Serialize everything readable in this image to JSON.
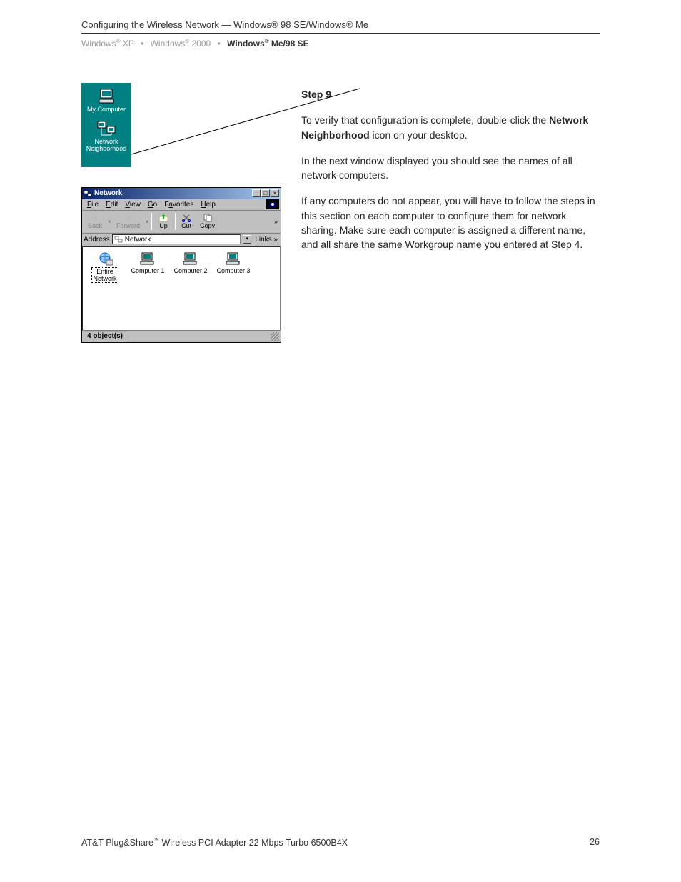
{
  "header": {
    "title": "Configuring the Wireless Network — Windows® 98 SE/Windows® Me"
  },
  "breadcrumb": {
    "item1": "Windows",
    "sup1": "®",
    "item1b": " XP",
    "sep1": "•",
    "item2": "Windows",
    "sup2": "®",
    "item2b": " 2000",
    "sep2": "•",
    "item3": "Windows",
    "sup3": "®",
    "item3b": " Me/98 SE"
  },
  "desktop": {
    "icon1_label": "My Computer",
    "icon2_line1": "Network",
    "icon2_line2": "Neighborhood"
  },
  "netwin": {
    "title": "Network",
    "win_min": "_",
    "win_max": "□",
    "win_close": "×",
    "menu": {
      "file": "File",
      "edit": "Edit",
      "view": "View",
      "go": "Go",
      "favorites": "Favorites",
      "help": "Help"
    },
    "toolbar": {
      "back": "Back",
      "forward": "Forward",
      "up": "Up",
      "cut": "Cut",
      "copy": "Copy",
      "more": "»"
    },
    "address_label": "Address",
    "address_value": "Network",
    "links_label": "Links »",
    "items": {
      "entire_line1": "Entire",
      "entire_line2": "Network",
      "comp1": "Computer 1",
      "comp2": "Computer 2",
      "comp3": "Computer 3"
    },
    "status": "4 object(s)"
  },
  "body": {
    "step_head": "Step 9",
    "p1a": "To verify that configuration is complete, double-click the ",
    "p1b": "Network Neighborhood",
    "p1c": " icon on your desktop.",
    "p2": "In the next window displayed you should see the names of all network computers.",
    "p3": "If any computers do not appear, you will have to follow the steps in this section on each computer to configure them for network sharing. Make sure each computer is assigned a different name, and all share the same Workgroup name you entered at Step 4."
  },
  "footer": {
    "left_a": "AT&T Plug&Share",
    "left_tm": "™",
    "left_b": " Wireless PCI Adapter 22 Mbps Turbo 6500B4X",
    "page": "26"
  }
}
